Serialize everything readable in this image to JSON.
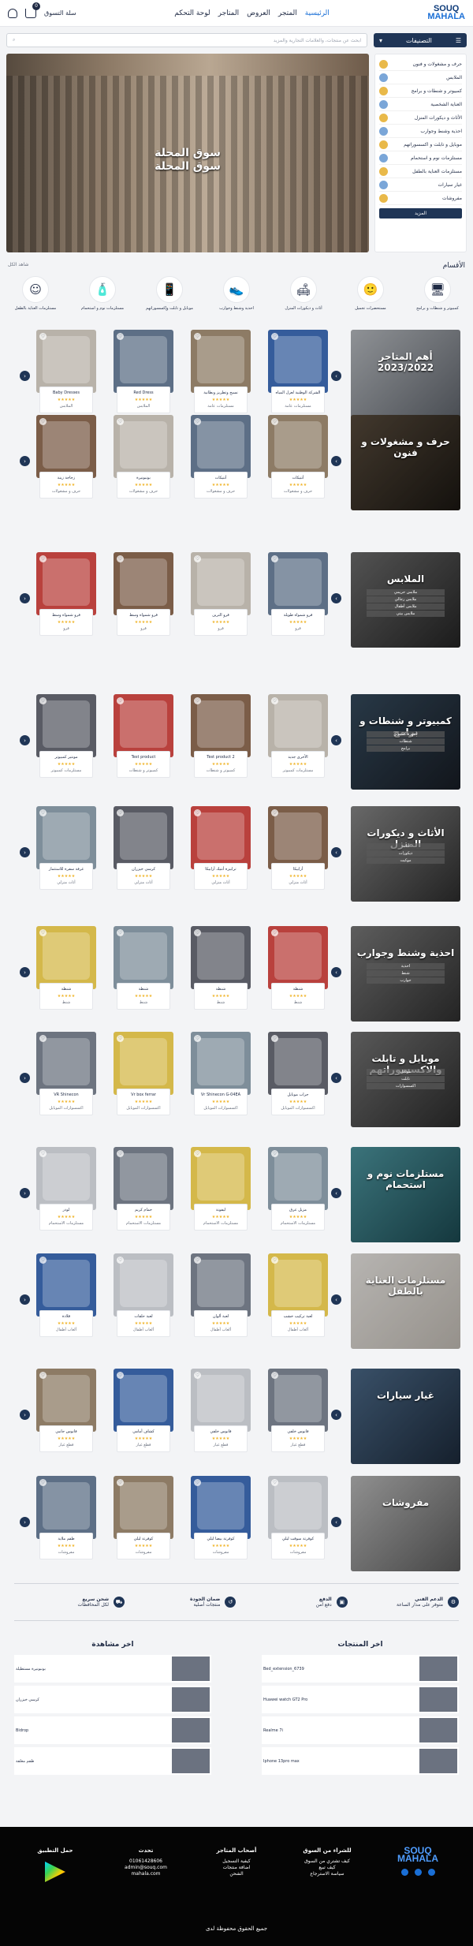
{
  "header": {
    "logo_lines": [
      "SOUQ",
      "MAHALA"
    ],
    "nav": [
      "الرئيسية",
      "المتجر",
      "العروض",
      "المتاجر",
      "لوحة التحكم"
    ],
    "cart_label": "سلة التسوق",
    "cart_count": "0"
  },
  "search": {
    "category_label": "التصنيفات",
    "placeholder": "ابحث عن منتجات، والعلامات التجارية والمزيد"
  },
  "sidebar_categories": [
    "حرف و مشغولات و فنون",
    "الملابس",
    "كمبيوتر و شنطات و برامج",
    "العناية الشخصية",
    "الأثاث و ديكورات المنزل",
    "احذية وشنط وجوارب",
    "موبايل و تابلت و اكسسوراتهم",
    "مستلزمات نوم و استحمام",
    "مستلزمات العناية بالطفل",
    "غيار سيارات",
    "مفروشات"
  ],
  "sidebar_more": "المزيد",
  "hero": {
    "title_ar": "سوق المحلة",
    "title_ar_2": "سوق المحلة"
  },
  "categories_section": {
    "title": "الأقسام",
    "view_all": "شاهد الكل"
  },
  "category_icons": [
    {
      "label": "كمبيوتر و شنطات و برامج",
      "icon": "computer-icon"
    },
    {
      "label": "مستحضرات تجميل",
      "icon": "face-icon"
    },
    {
      "label": "أثاث و ديكورات المنزل",
      "icon": "sofa-icon"
    },
    {
      "label": "احذية وشنط وجوارب",
      "icon": "shoe-icon"
    },
    {
      "label": "موبايل و تابلت وإكسسوراتهم",
      "icon": "tablet-icon"
    },
    {
      "label": "مستلزمات نوم و استحمام",
      "icon": "bottle-icon"
    },
    {
      "label": "مستلزمات العناية بالطفل",
      "icon": "minion-icon"
    }
  ],
  "sections": [
    {
      "title": "أهم المتاجر 2023/2022",
      "subs": [],
      "products": [
        {
          "name": "الشركة الوطنية لعزل المياه",
          "seller": "مستلزمات عامة"
        },
        {
          "name": "نسيج وتطريز وبطانية",
          "seller": "مستلزمات عامة"
        },
        {
          "name": "Red Dress",
          "seller": "الملابس"
        },
        {
          "name": "Baby Dresses",
          "seller": "الملابس"
        }
      ]
    },
    {
      "title": "حرف و مشغولات و فنون",
      "subs": [],
      "products": [
        {
          "name": "أنتيكات",
          "seller": "حرف و مشغولات"
        },
        {
          "name": "أنتيكات",
          "seller": "حرف و مشغولات"
        },
        {
          "name": "بونبونيرة",
          "seller": "حرف و مشغولات"
        },
        {
          "name": "زجاجة زينة",
          "seller": "حرف و مشغولات"
        }
      ]
    },
    {
      "title": "الملابس",
      "subs": [
        "ملابس حريمي",
        "ملابس رجالي",
        "ملابس أطفال",
        "ملابس بيتي"
      ],
      "products": [
        {
          "name": "قرو شمواه طويلة",
          "seller": "قرو"
        },
        {
          "name": "قرو الترين",
          "seller": "قرو"
        },
        {
          "name": "قرو شمواه وسط",
          "seller": "قرو"
        },
        {
          "name": "قرو شمواه وسط",
          "seller": "قرو"
        }
      ]
    },
    {
      "title": "كمبيوتر و شنطات و برامج",
      "subs": [
        "أجهزة كمبيوتر",
        "شنطات",
        "برامج"
      ],
      "products": [
        {
          "name": "الأخرى جديد",
          "seller": "مستلزمات كمبيوتر"
        },
        {
          "name": "Test product 2",
          "seller": "كمبيوتر و شنطات"
        },
        {
          "name": "Test product",
          "seller": "كمبيوتر و شنطات"
        },
        {
          "name": "مونتير كمبيوتر",
          "seller": "مستلزمات كمبيوتر"
        }
      ]
    },
    {
      "title": "الأثاث و ديكورات المنزل",
      "subs": [
        "أثاث",
        "ديكورات",
        "موكيت"
      ],
      "products": [
        {
          "name": "أرابيكا",
          "seller": "أثاث منزلي"
        },
        {
          "name": "ترابيزة أنتيك أرابيكا",
          "seller": "أثاث منزلي"
        },
        {
          "name": "كرسي خيزران",
          "seller": "أثاث منزلي"
        },
        {
          "name": "غرفة سفرة للاستثمار",
          "seller": "أثاث منزلي"
        }
      ]
    },
    {
      "title": "احذية وشنط وجوارب",
      "subs": [
        "احذية",
        "شنط",
        "جوارب"
      ],
      "products": [
        {
          "name": "شنطة",
          "seller": "شنط"
        },
        {
          "name": "شنطة",
          "seller": "شنط"
        },
        {
          "name": "شنطة",
          "seller": "شنط"
        },
        {
          "name": "شنطة",
          "seller": "شنط"
        }
      ]
    },
    {
      "title": "موبايل و تابلت والاكسسوراتهم",
      "subs": [
        "موبايل",
        "تابلت",
        "اكسسوارات"
      ],
      "products": [
        {
          "name": "جراب موبايل",
          "seller": "اكسسوارات الموبايل"
        },
        {
          "name": "Vr Shinecon G-04EA",
          "seller": "اكسسوارات الموبايل"
        },
        {
          "name": "Vr box ferrar",
          "seller": "اكسسوارات الموبايل"
        },
        {
          "name": "VR Shinecon",
          "seller": "اكسسوارات الموبايل"
        }
      ]
    },
    {
      "title": "مستلزمات نوم و استحمام",
      "subs": [],
      "products": [
        {
          "name": "مزيل عرق",
          "seller": "مستلزمات الاستحمام"
        },
        {
          "name": "ليفونة",
          "seller": "مستلزمات الاستحمام"
        },
        {
          "name": "حمام كريم",
          "seller": "مستلزمات الاستحمام"
        },
        {
          "name": "لودر",
          "seller": "مستلزمات الاستحمام"
        }
      ]
    },
    {
      "title": "مستلزمات العناية بالطفل",
      "subs": [],
      "products": [
        {
          "name": "لعبة تركيب خشب",
          "seller": "ألعاب أطفال"
        },
        {
          "name": "لعبة ألوان",
          "seller": "ألعاب أطفال"
        },
        {
          "name": "لعبة حلقات",
          "seller": "ألعاب أطفال"
        },
        {
          "name": "قلادة",
          "seller": "ألعاب أطفال"
        }
      ]
    },
    {
      "title": "غيار سيارات",
      "subs": [],
      "products": [
        {
          "name": "فانوس خلفي",
          "seller": "قطع غيار"
        },
        {
          "name": "فانوس خلفي",
          "seller": "قطع غيار"
        },
        {
          "name": "كشاف أمامي",
          "seller": "قطع غيار"
        },
        {
          "name": "فانوس جانبي",
          "seller": "قطع غيار"
        }
      ]
    },
    {
      "title": "مفروشات",
      "subs": [],
      "products": [
        {
          "name": "كوفرتة سوفت ليلي",
          "seller": "مفروشات"
        },
        {
          "name": "كوفرتة بيضا ليلي",
          "seller": "مفروشات"
        },
        {
          "name": "كوفرتة ليلي",
          "seller": "مفروشات"
        },
        {
          "name": "طقم ملاية",
          "seller": "مفروشات"
        }
      ]
    }
  ],
  "features": [
    {
      "title": "الدعم الفني",
      "text": "متوفر على مدار الساعة"
    },
    {
      "title": "الدفع",
      "text": "دفع آمن"
    },
    {
      "title": "ضمان الجودة",
      "text": "منتجات أصلية"
    },
    {
      "title": "شحن سريع",
      "text": "لكل المحافظات"
    }
  ],
  "latest_products_title": "اخر المنتجات",
  "latest_products": [
    "Bed_extension_6739",
    "Huawei watch GT2 Pro",
    "Realme 7i",
    "Iphone 13pro max"
  ],
  "latest_views_title": "اخر مشاهدة",
  "latest_views": [
    "بونبونيرة مستطيلة",
    "كرسي خيزران",
    "Bidrop",
    "طقم معلقة"
  ],
  "footer": {
    "col1_title": "للشراء من السوق",
    "col1_items": [
      "كيف تشتري من السوق",
      "كيف تبيع",
      "سياسة الاسترجاع"
    ],
    "col2_title": "أصحاب المتاجر",
    "col2_items": [
      "كيفية التسجيل",
      "اضافة منتجات",
      "الشحن"
    ],
    "col3_title": "تحدث",
    "col3_items": [
      "01061428606",
      "admin@souq.com",
      "mahala.com"
    ],
    "col4_title": "حمل التطبيق",
    "rights": "جميع الحقوق محفوظة لدى"
  },
  "colors": {
    "primary": "#1f3556",
    "accent": "#1a6fd6",
    "rating": "#f0b429"
  }
}
